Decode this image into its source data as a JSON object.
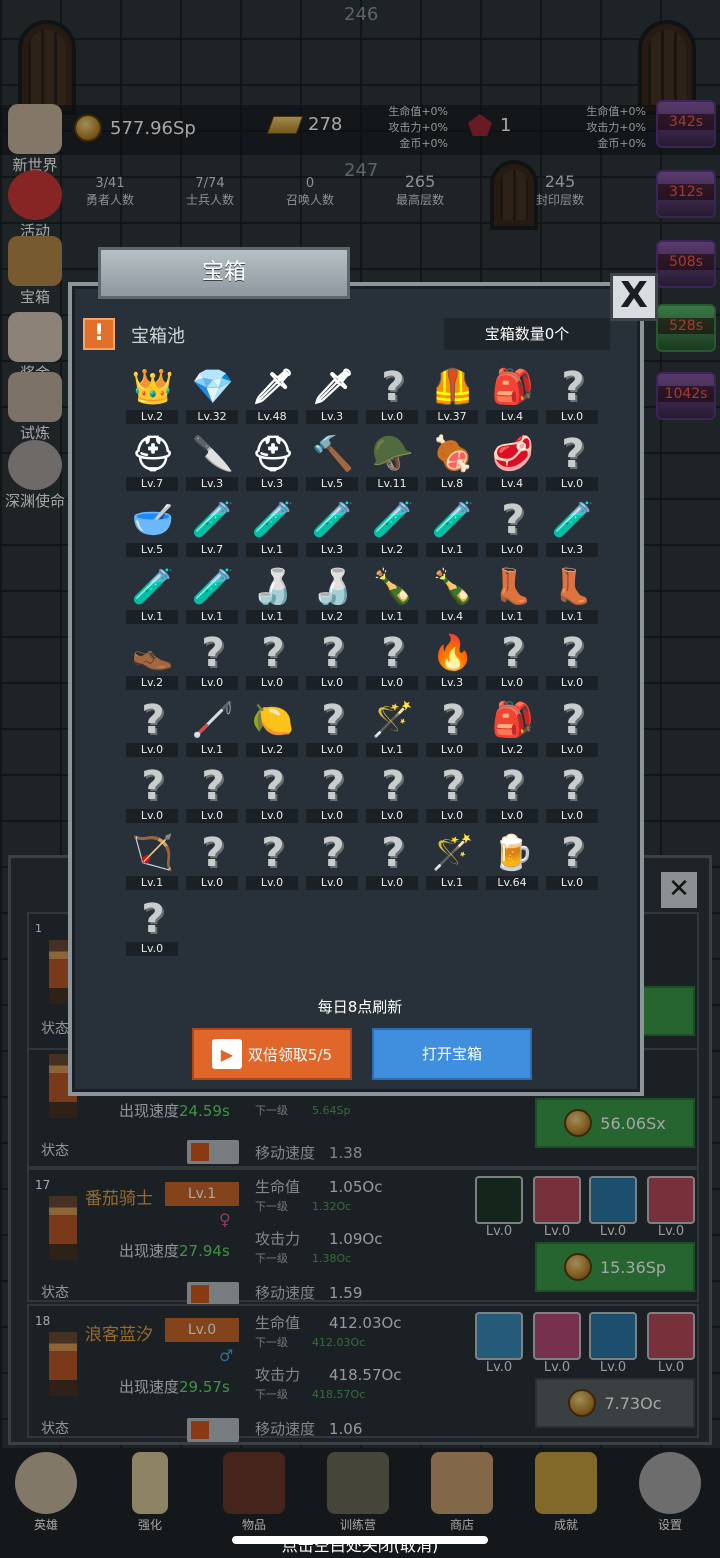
{
  "floors": {
    "top": "246",
    "mid": "247"
  },
  "resources": {
    "coins": "577.96Sp",
    "bars": "278",
    "gems": "1"
  },
  "bonus_left": [
    "生命值+0%",
    "攻击力+0%",
    "金币+0%"
  ],
  "bonus_right": [
    "生命值+0%",
    "攻击力+0%",
    "金币+0%"
  ],
  "stats": [
    {
      "value": "3/41",
      "label": "勇者人数"
    },
    {
      "value": "7/74",
      "label": "士兵人数"
    },
    {
      "value": "0",
      "label": "召唤人数"
    },
    {
      "value": "265",
      "label": "最高层数"
    },
    {
      "value": "245",
      "label": "封印层数"
    }
  ],
  "side_left": [
    "新世界",
    "活动",
    "宝箱",
    "奖金",
    "试炼",
    "深渊使命"
  ],
  "side_right": [
    "342s",
    "312s",
    "508s",
    "528s",
    "1042s"
  ],
  "dialog": {
    "title": "宝箱",
    "pool_label": "宝箱池",
    "count_label": "宝箱数量0个",
    "refresh": "每日8点刷新",
    "double_btn": "双倍领取5/5",
    "open_btn": "打开宝箱",
    "close": "X"
  },
  "items": [
    {
      "i": "👑",
      "lv": "Lv.2"
    },
    {
      "i": "💎",
      "lv": "Lv.32"
    },
    {
      "i": "🗡",
      "lv": "Lv.48"
    },
    {
      "i": "🗡",
      "lv": "Lv.3"
    },
    {
      "i": "?",
      "lv": "Lv.0"
    },
    {
      "i": "🦺",
      "lv": "Lv.37"
    },
    {
      "i": "🎒",
      "lv": "Lv.4"
    },
    {
      "i": "?",
      "lv": "Lv.0"
    },
    {
      "i": "⛑",
      "lv": "Lv.7"
    },
    {
      "i": "🔪",
      "lv": "Lv.3"
    },
    {
      "i": "⛑",
      "lv": "Lv.3"
    },
    {
      "i": "🔨",
      "lv": "Lv.5"
    },
    {
      "i": "🪖",
      "lv": "Lv.11"
    },
    {
      "i": "🍖",
      "lv": "Lv.8"
    },
    {
      "i": "🥩",
      "lv": "Lv.4"
    },
    {
      "i": "?",
      "lv": "Lv.0"
    },
    {
      "i": "🥣",
      "lv": "Lv.5"
    },
    {
      "i": "🧪",
      "lv": "Lv.7"
    },
    {
      "i": "🧪",
      "lv": "Lv.1"
    },
    {
      "i": "🧪",
      "lv": "Lv.3"
    },
    {
      "i": "🧪",
      "lv": "Lv.2"
    },
    {
      "i": "🧪",
      "lv": "Lv.1"
    },
    {
      "i": "?",
      "lv": "Lv.0"
    },
    {
      "i": "🧪",
      "lv": "Lv.3"
    },
    {
      "i": "🧪",
      "lv": "Lv.1"
    },
    {
      "i": "🧪",
      "lv": "Lv.1"
    },
    {
      "i": "🍶",
      "lv": "Lv.1"
    },
    {
      "i": "🍶",
      "lv": "Lv.2"
    },
    {
      "i": "🍾",
      "lv": "Lv.1"
    },
    {
      "i": "🍾",
      "lv": "Lv.4"
    },
    {
      "i": "👢",
      "lv": "Lv.1"
    },
    {
      "i": "👢",
      "lv": "Lv.1"
    },
    {
      "i": "👞",
      "lv": "Lv.2"
    },
    {
      "i": "?",
      "lv": "Lv.0"
    },
    {
      "i": "?",
      "lv": "Lv.0"
    },
    {
      "i": "?",
      "lv": "Lv.0"
    },
    {
      "i": "?",
      "lv": "Lv.0"
    },
    {
      "i": "🔥",
      "lv": "Lv.3"
    },
    {
      "i": "?",
      "lv": "Lv.0"
    },
    {
      "i": "?",
      "lv": "Lv.0"
    },
    {
      "i": "?",
      "lv": "Lv.0"
    },
    {
      "i": "🦯",
      "lv": "Lv.1"
    },
    {
      "i": "🍋",
      "lv": "Lv.2"
    },
    {
      "i": "?",
      "lv": "Lv.0"
    },
    {
      "i": "🪄",
      "lv": "Lv.1"
    },
    {
      "i": "?",
      "lv": "Lv.0"
    },
    {
      "i": "🎒",
      "lv": "Lv.2"
    },
    {
      "i": "?",
      "lv": "Lv.0"
    },
    {
      "i": "?",
      "lv": "Lv.0"
    },
    {
      "i": "?",
      "lv": "Lv.0"
    },
    {
      "i": "?",
      "lv": "Lv.0"
    },
    {
      "i": "?",
      "lv": "Lv.0"
    },
    {
      "i": "?",
      "lv": "Lv.0"
    },
    {
      "i": "?",
      "lv": "Lv.0"
    },
    {
      "i": "?",
      "lv": "Lv.0"
    },
    {
      "i": "?",
      "lv": "Lv.0"
    },
    {
      "i": "🏹",
      "lv": "Lv.1"
    },
    {
      "i": "?",
      "lv": "Lv.0"
    },
    {
      "i": "?",
      "lv": "Lv.0"
    },
    {
      "i": "?",
      "lv": "Lv.0"
    },
    {
      "i": "?",
      "lv": "Lv.0"
    },
    {
      "i": "🪄",
      "lv": "Lv.1"
    },
    {
      "i": "🍺",
      "lv": "Lv.64"
    },
    {
      "i": "?",
      "lv": "Lv.0"
    },
    {
      "i": "?",
      "lv": "Lv.0"
    }
  ],
  "rows": [
    {
      "num": "",
      "name": "",
      "lvl": "",
      "speed_label": "出现速度",
      "speed": "24.59s",
      "status": "状态",
      "hp_label": "",
      "hp": "",
      "next": "下一级",
      "hp_next": "5.64Sp",
      "atk_label": "",
      "atk": "",
      "atk_next": "",
      "move_label": "移动速度",
      "move": "1.38",
      "skills": [
        "",
        "",
        "",
        ""
      ],
      "btn": "56.06Sx"
    },
    {
      "num": "17",
      "name": "番茄骑士",
      "lvl": "Lv.1",
      "speed_label": "出现速度",
      "speed": "27.94s",
      "status": "状态",
      "hp_label": "生命值",
      "hp": "1.05Oc",
      "next": "下一级",
      "hp_next": "1.32Oc",
      "atk_label": "攻击力",
      "atk": "1.09Oc",
      "atk_next": "1.38Oc",
      "move_label": "移动速度",
      "move": "1.59",
      "skills": [
        "Lv.0",
        "Lv.0",
        "Lv.0",
        "Lv.0"
      ],
      "btn": "15.36Sp"
    },
    {
      "num": "18",
      "name": "浪客蓝汐",
      "lvl": "Lv.0",
      "speed_label": "出现速度",
      "speed": "29.57s",
      "status": "状态",
      "hp_label": "生命值",
      "hp": "412.03Oc",
      "next": "下一级",
      "hp_next": "412.03Oc",
      "atk_label": "攻击力",
      "atk": "418.57Oc",
      "atk_next": "418.57Oc",
      "move_label": "移动速度",
      "move": "1.06",
      "skills": [
        "Lv.0",
        "Lv.0",
        "Lv.0",
        "Lv.0"
      ],
      "btn": "7.73Oc"
    }
  ],
  "row1_head": {
    "num": "1",
    "status": "状态"
  },
  "nav": [
    "英雄",
    "强化",
    "物品",
    "训练营",
    "商店",
    "成就",
    "设置"
  ],
  "bottom_hint": "点击空白处关闭(取消)"
}
